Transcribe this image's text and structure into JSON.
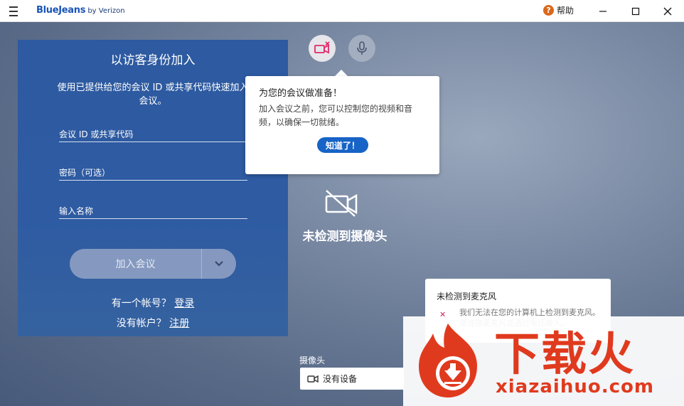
{
  "titlebar": {
    "brand_main": "BlueJeans",
    "brand_by": " by Verizon",
    "help_label": "帮助"
  },
  "guest_panel": {
    "title": "以访客身份加入",
    "description": "使用已提供给您的会议 ID 或共享代码快速加入会议。",
    "meeting_id_placeholder": "会议 ID 或共享代码",
    "passcode_placeholder": "密码（可选）",
    "name_placeholder": "输入名称",
    "join_label": "加入会议",
    "have_account_text": "有一个帐号？",
    "login_link": "登录",
    "no_account_text": "没有帐户？",
    "register_link": "注册"
  },
  "tooltip": {
    "title": "为您的会议做准备！",
    "body": "加入会议之前，您可以控制您的视频和音频，以确保一切就绪。",
    "button": "知道了！"
  },
  "camera_status": {
    "text": "未检测到摄像头"
  },
  "mic_popup": {
    "title": "未检测到麦克风",
    "body": "我们无法在您的计算机上检测到麦克风。请连接麦克风或通过电话拨入。"
  },
  "camera_select": {
    "label": "摄像头",
    "value": "没有设备"
  },
  "watermark": {
    "big_text": "下载火",
    "url": "xiazaihuo.com"
  },
  "colors": {
    "accent": "#1763c6",
    "panel": "#2e5ba2",
    "camera_off": "#e0286a",
    "watermark": "#e03a1e"
  }
}
